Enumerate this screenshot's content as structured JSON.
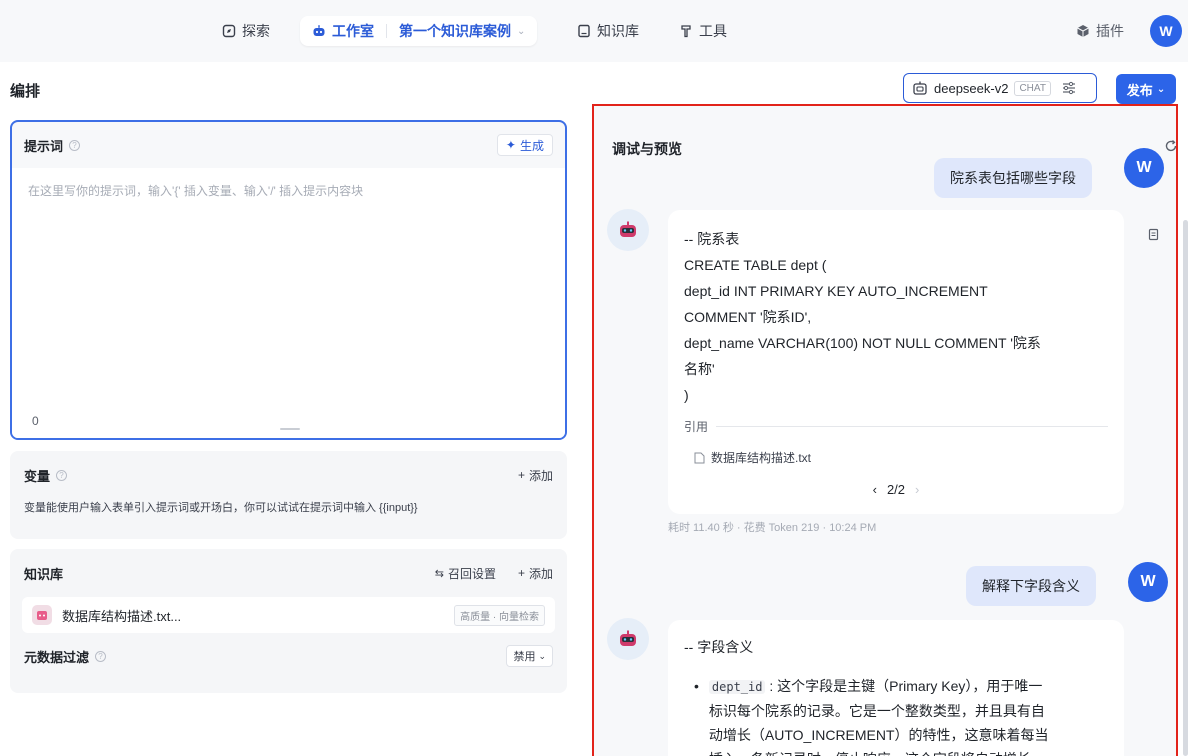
{
  "nav": {
    "explore": "探索",
    "workspace": "工作室",
    "current_kb": "第一个知识库案例",
    "knowledge": "知识库",
    "tools": "工具",
    "plugins": "插件",
    "avatar": "W"
  },
  "header": {
    "title": "编排",
    "model": "deepseek-v2",
    "model_tag": "CHAT",
    "publish": "发布"
  },
  "prompt": {
    "title": "提示词",
    "generate": "生成",
    "placeholder": "在这里写你的提示词，输入'{' 插入变量、输入'/' 插入提示内容块",
    "count": "0"
  },
  "variables": {
    "title": "变量",
    "add": "添加",
    "description": "变量能使用户输入表单引入提示词或开场白，你可以试试在提示词中输入 {{input}}"
  },
  "knowledge": {
    "title": "知识库",
    "recall": "召回设置",
    "add": "添加",
    "item_name": "数据库结构描述.txt...",
    "item_tag": "高质量 · 向量检索"
  },
  "metadata": {
    "title": "元数据过滤",
    "value": "禁用"
  },
  "preview": {
    "title": "调试与预览",
    "user_q1": "院系表包括哪些字段",
    "answer1_lines": [
      "-- 院系表",
      "CREATE TABLE dept (",
      "dept_id INT PRIMARY KEY AUTO_INCREMENT",
      "COMMENT '院系ID',",
      "dept_name VARCHAR(100) NOT NULL COMMENT '院系",
      "名称'",
      ")"
    ],
    "citation_label": "引用",
    "citation_file": "数据库结构描述.txt",
    "pager": "2/2",
    "meta": "耗时 11.40 秒 · 花费 Token 219 · 10:24 PM",
    "user_q2": "解释下字段含义",
    "answer2_heading": "-- 字段含义",
    "answer2_code": "dept_id",
    "answer2_lines": [
      ": 这个字段是主键（Primary Key），用于唯一",
      "标识每个院系的记录。它是一个整数类型，并且具有自",
      "动增长（AUTO_INCREMENT）的特性，这意味着每当",
      "插入一条新记录时，停止响应，这个字段将自动增长"
    ],
    "user_avatar": "W"
  }
}
